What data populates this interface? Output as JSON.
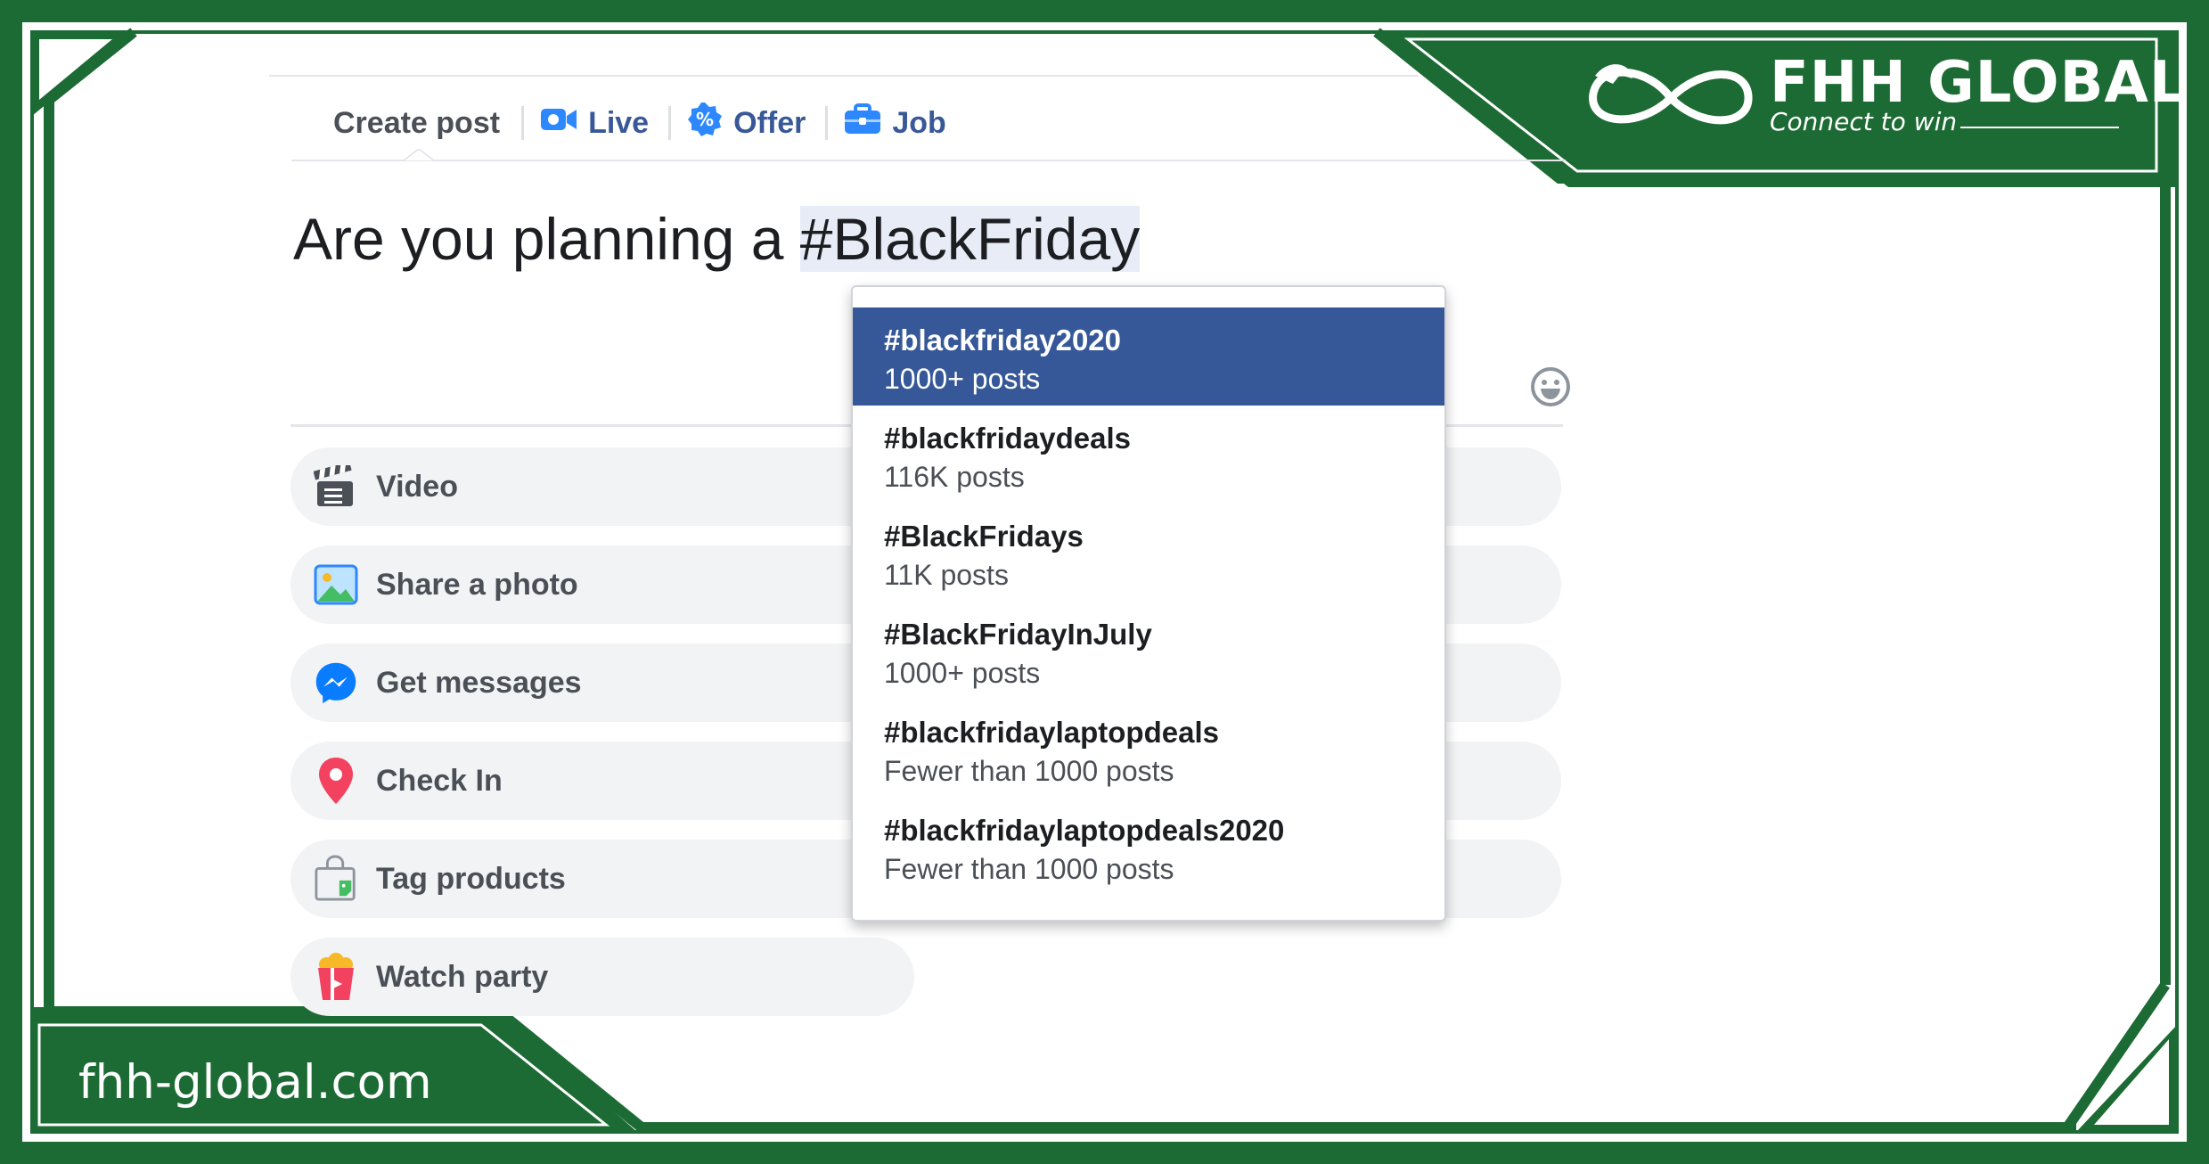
{
  "brand": {
    "logo_name": "FHH GLOBAL",
    "tagline": "Connect to win",
    "website": "fhh-global.com",
    "frame_color": "#1d6b34",
    "logo_icon": "dragon-infinity-icon"
  },
  "tabs": {
    "create_post": "Create post",
    "live": "Live",
    "offer": "Offer",
    "job": "Job"
  },
  "composer": {
    "text_before": "Are you planning a ",
    "hashtag": "#BlackFriday"
  },
  "actions": {
    "video": "Video",
    "share_photo": "Share a photo",
    "get_messages": "Get messages",
    "check_in": "Check In",
    "tag_products": "Tag products",
    "watch_party": "Watch party"
  },
  "suggestions": [
    {
      "tag": "#blackfriday2020",
      "count": "1000+ posts",
      "selected": true
    },
    {
      "tag": "#blackfridaydeals",
      "count": "116K posts"
    },
    {
      "tag": "#BlackFridays",
      "count": "11K posts"
    },
    {
      "tag": "#BlackFridayInJuly",
      "count": "1000+ posts"
    },
    {
      "tag": "#blackfridaylaptopdeals",
      "count": "Fewer than 1000 posts"
    },
    {
      "tag": "#blackfridaylaptopdeals2020",
      "count": "Fewer than 1000 posts"
    }
  ],
  "colors": {
    "facebook_blue": "#385898",
    "selected_bg": "#365899",
    "pill_bg": "#f2f3f5"
  }
}
